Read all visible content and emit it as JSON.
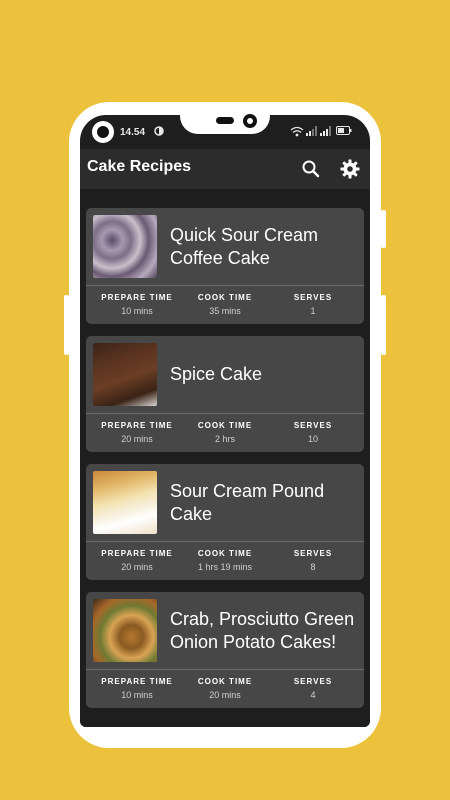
{
  "status_bar": {
    "time": "14.54"
  },
  "app_bar": {
    "title": "Cake Recipes"
  },
  "stat_labels": {
    "prep": "PREPARE TIME",
    "cook": "COOK TIME",
    "serves": "SERVES"
  },
  "recipes": [
    {
      "title": "Quick Sour Cream Coffee Cake",
      "prep": "10 mins",
      "cook": "35 mins",
      "serves": "1"
    },
    {
      "title": "Spice Cake",
      "prep": "20 mins",
      "cook": "2 hrs",
      "serves": "10"
    },
    {
      "title": "Sour Cream Pound Cake",
      "prep": "20 mins",
      "cook": "1 hrs 19 mins",
      "serves": "8"
    },
    {
      "title": "Crab, Prosciutto Green Onion Potato Cakes!",
      "prep": "10 mins",
      "cook": "20 mins",
      "serves": "4"
    }
  ],
  "colors": {
    "background": "#ecc23d",
    "app_bar": "#2c2c2c",
    "card": "#474747",
    "screen": "#1e1e1e"
  },
  "icons": {
    "search": "search-icon",
    "settings": "gear-icon"
  }
}
